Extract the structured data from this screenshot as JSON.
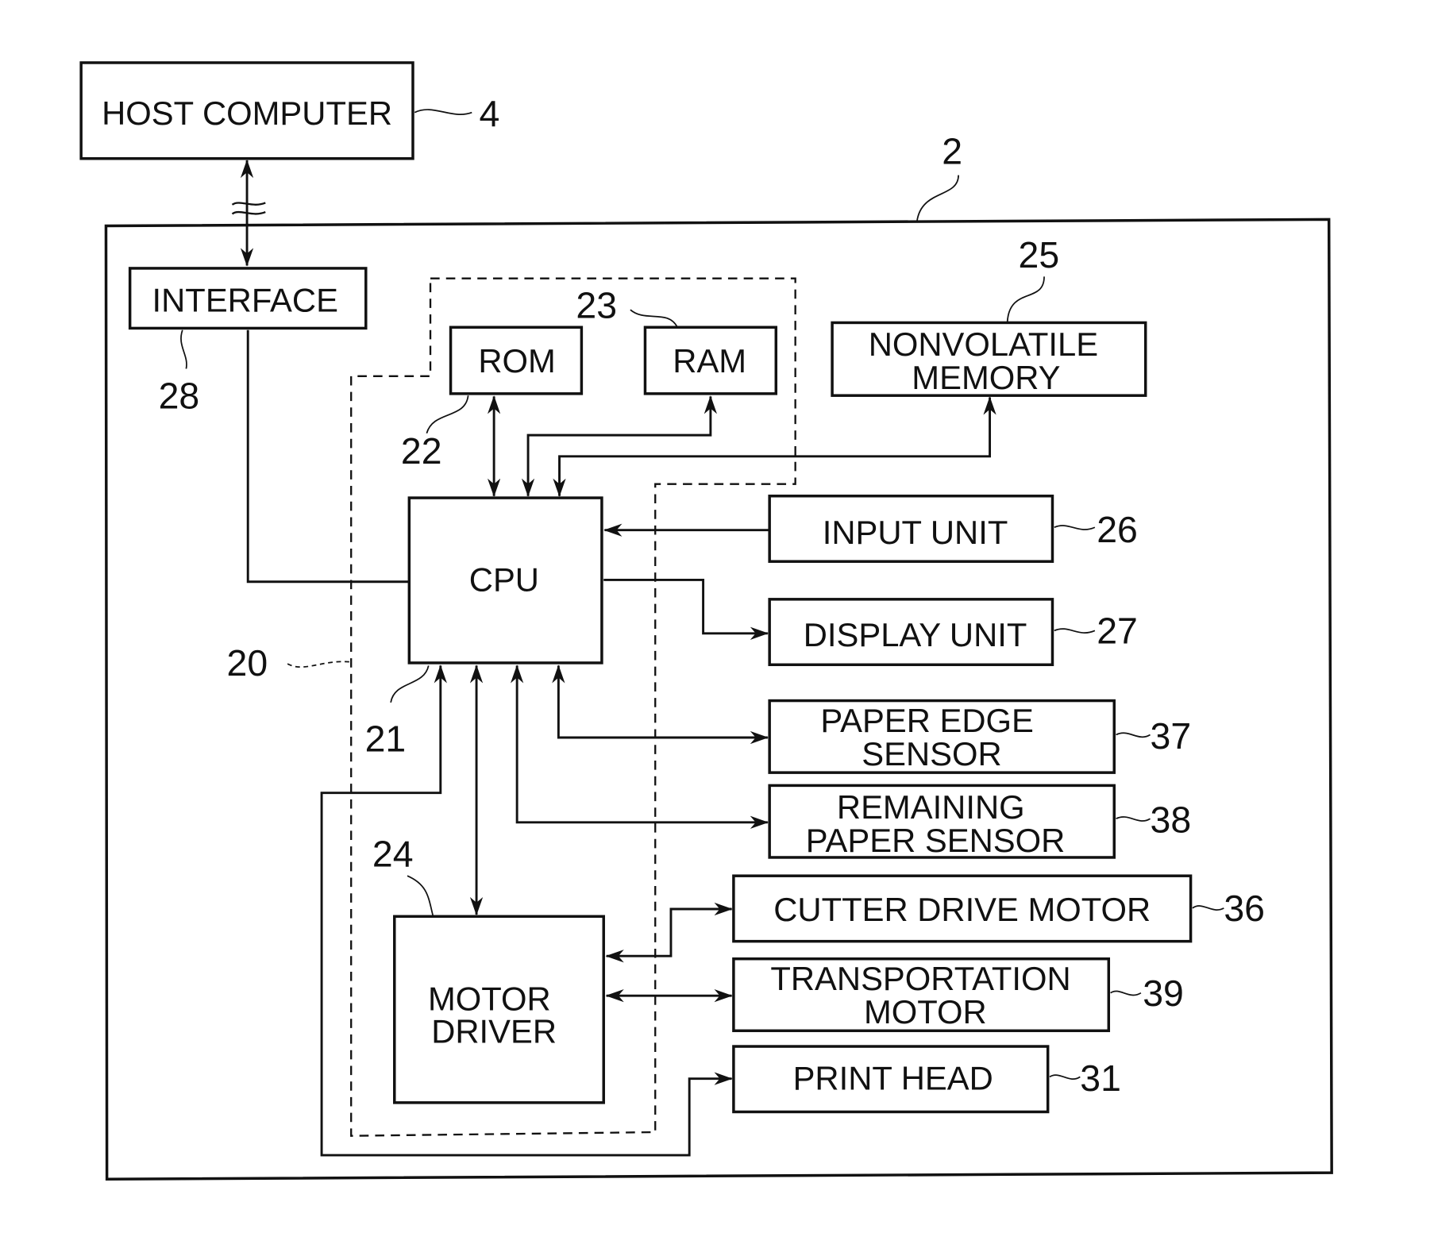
{
  "diagram": {
    "type": "block-diagram",
    "blocks": {
      "host": {
        "label": "HOST COMPUTER",
        "ref": "4"
      },
      "interface": {
        "label": "INTERFACE",
        "ref": "28"
      },
      "rom": {
        "label": "ROM",
        "ref": "22"
      },
      "ram": {
        "label": "RAM",
        "ref": "23"
      },
      "nvm": {
        "line1": "NONVOLATILE",
        "line2": "MEMORY",
        "ref": "25"
      },
      "cpu": {
        "label": "CPU",
        "ref": "21"
      },
      "input": {
        "label": "INPUT UNIT",
        "ref": "26"
      },
      "display": {
        "label": "DISPLAY UNIT",
        "ref": "27"
      },
      "paper_edge": {
        "line1": "PAPER EDGE",
        "line2": "SENSOR",
        "ref": "37"
      },
      "remaining": {
        "line1": "REMAINING",
        "line2": "PAPER SENSOR",
        "ref": "38"
      },
      "cutter": {
        "label": "CUTTER DRIVE MOTOR",
        "ref": "36"
      },
      "transport": {
        "line1": "TRANSPORTATION",
        "line2": "MOTOR",
        "ref": "39"
      },
      "printhead": {
        "label": "PRINT HEAD",
        "ref": "31"
      },
      "motor_driver": {
        "line1": "MOTOR",
        "line2": "DRIVER",
        "ref": "24"
      }
    },
    "groups": {
      "printer": {
        "ref": "2"
      },
      "controller": {
        "ref": "20"
      }
    }
  }
}
